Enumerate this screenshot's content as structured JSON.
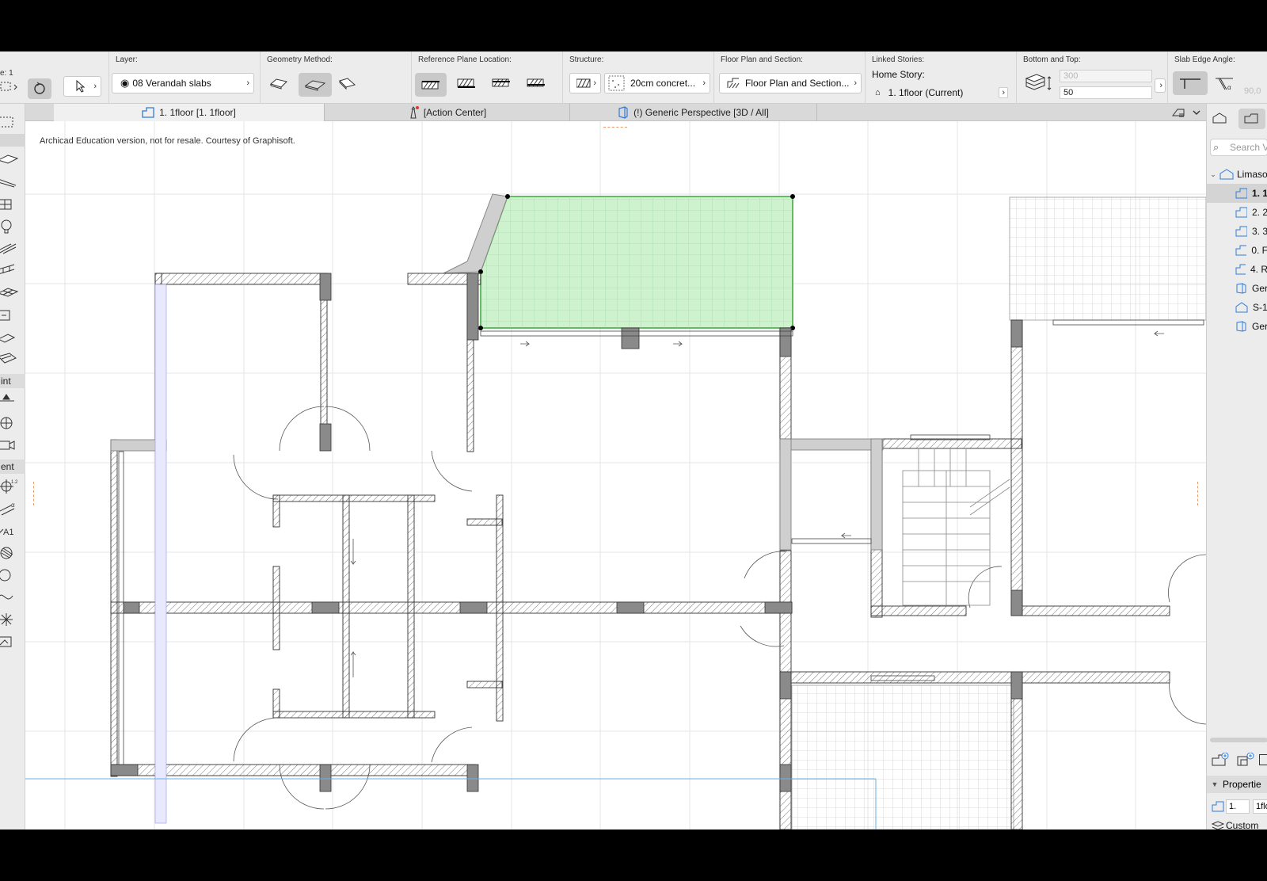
{
  "infobox": {
    "scale_fragment": "e: 1",
    "layer_label": "Layer:",
    "layer_value": "08 Verandah slabs",
    "geometry_label": "Geometry Method:",
    "refplane_label": "Reference Plane Location:",
    "structure_label": "Structure:",
    "structure_value": "20cm concret...",
    "floorplan_label": "Floor Plan and Section:",
    "floorplan_value": "Floor Plan and Section...",
    "linked_label": "Linked Stories:",
    "home_story_label": "Home Story:",
    "home_story_value": "1. 1floor  (Current)",
    "bottomtop_label": "Bottom and Top:",
    "top_value": "300",
    "bottom_value": "50",
    "edge_angle_label": "Slab Edge Angle:",
    "edge_angle_value": "90,0"
  },
  "tabs": [
    {
      "label": "1. 1floor  [1. 1floor]",
      "active": true
    },
    {
      "label": "[Action Center]",
      "active": false
    },
    {
      "label": "(!) Generic Perspective [3D / All]",
      "active": false
    }
  ],
  "toolbox": {
    "categories": [
      "int",
      "ent"
    ]
  },
  "canvas": {
    "watermark": "Archicad Education version, not for resale. Courtesy of Graphisoft.",
    "selection_color": "#cdf2cd",
    "selection_stroke": "#3aa63a"
  },
  "navigator": {
    "search_placeholder": "Search V",
    "root": "Limaso",
    "items": [
      "1. 1",
      "2. 2",
      "3. 3",
      "0. F",
      "4. R",
      "Ger",
      "S-1",
      "Ger"
    ],
    "properties_label": "Propertie",
    "prop_number": "1.",
    "prop_name": "1flo",
    "prop_custom": "Custom"
  }
}
